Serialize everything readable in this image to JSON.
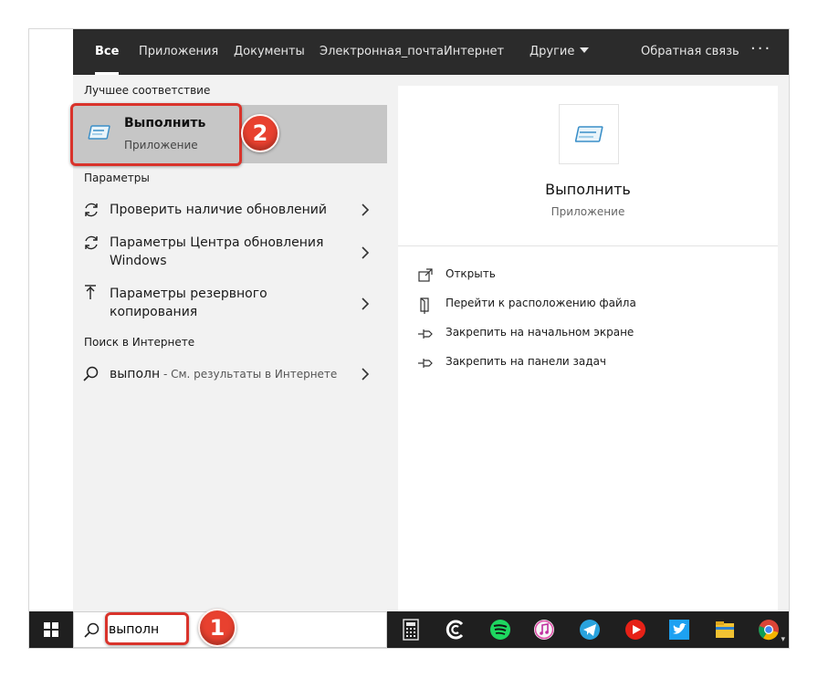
{
  "tabs": [
    {
      "label": "Все"
    },
    {
      "label": "Приложения"
    },
    {
      "label": "Документы"
    },
    {
      "label": "Электронная_почта"
    },
    {
      "label": "Интернет"
    },
    {
      "label": "Другие"
    }
  ],
  "feedback_label": "Обратная связь",
  "more_label": "···",
  "best_match": {
    "section_label": "Лучшее соответствие",
    "title": "Выполнить",
    "subtitle": "Приложение",
    "badge": "2"
  },
  "settings": {
    "section_label": "Параметры",
    "items": [
      {
        "line1": "Проверить наличие обновлений",
        "line2": ""
      },
      {
        "line1": "Параметры Центра обновления",
        "line2": "Windows"
      },
      {
        "line1": "Параметры резервного",
        "line2": "копирования"
      }
    ]
  },
  "web": {
    "section_label": "Поиск в Интернете",
    "query": "выполн",
    "sub": " - См. результаты в Интернете"
  },
  "preview": {
    "title": "Выполнить",
    "subtitle": "Приложение",
    "actions": [
      {
        "label": "Открыть",
        "icon": "open-icon"
      },
      {
        "label": "Перейти к расположению файла",
        "icon": "file-location-icon"
      },
      {
        "label": "Закрепить на начальном экране",
        "icon": "pin-start-icon"
      },
      {
        "label": "Закрепить на панели задач",
        "icon": "pin-taskbar-icon"
      }
    ]
  },
  "taskbar": {
    "search_value": "выполн",
    "badge": "1",
    "apps": [
      "calculator-icon",
      "app-c-icon",
      "spotify-icon",
      "itunes-icon",
      "telegram-icon",
      "youtube-icon",
      "twitter-icon",
      "file-explorer-icon",
      "chrome-icon"
    ]
  },
  "colors": {
    "tabs_bg": "#2b2b2b",
    "highlight_red": "#d9332b",
    "badge_red": "#e8412f",
    "selected_bg": "#c6c6c6"
  }
}
